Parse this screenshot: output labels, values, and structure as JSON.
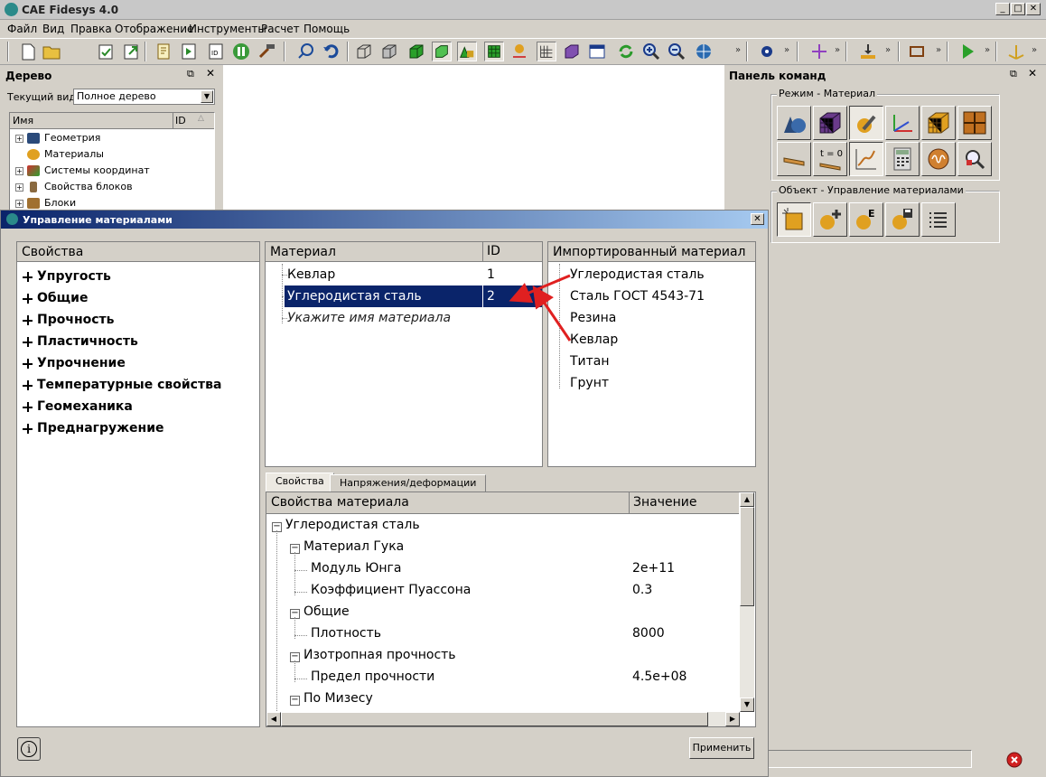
{
  "app": {
    "title": "CAE Fidesys 4.0",
    "minimize": "_",
    "maximize": "□",
    "close": "✕"
  },
  "menu": [
    "Файл",
    "Вид",
    "Правка",
    "Отображение",
    "Инструменты",
    "Расчет",
    "Помощь"
  ],
  "tree_panel": {
    "title": "Дерево",
    "view_label": "Текущий вид",
    "view_value": "Полное дерево",
    "col_name": "Имя",
    "col_id": "ID",
    "items": [
      "Геометрия",
      "Материалы",
      "Системы координат",
      "Свойства блоков",
      "Блоки"
    ]
  },
  "command_panel": {
    "title": "Панель команд",
    "mode_group": "Режим - Материал",
    "object_group": "Объект - Управление материалами",
    "t0_label": "t = 0"
  },
  "dialog": {
    "title": "Управление материалами",
    "properties_header": "Свойства",
    "properties": [
      "Упругость",
      "Общие",
      "Прочность",
      "Пластичность",
      "Упрочнение",
      "Температурные свойства",
      "Геомеханика",
      "Преднагружение"
    ],
    "material_header": "Материал",
    "id_header": "ID",
    "materials": [
      {
        "name": "Кевлар",
        "id": "1"
      },
      {
        "name": "Углеродистая сталь",
        "id": "2"
      }
    ],
    "new_material_hint": "Укажите имя материала",
    "imported_header": "Импортированный материал",
    "imported": [
      "Углеродистая сталь",
      "Сталь ГОСТ 4543-71",
      "Резина",
      "Кевлар",
      "Титан",
      "Грунт"
    ],
    "tabs": [
      "Свойства",
      "Напряжения/деформации"
    ],
    "prop_col": "Свойства материала",
    "value_col": "Значение",
    "prop_tree": {
      "root": "Углеродистая сталь",
      "hooke": "Материал Гука",
      "young": "Модуль Юнга",
      "young_val": "2e+11",
      "poisson": "Коэффициент Пуассона",
      "poisson_val": "0.3",
      "general": "Общие",
      "density": "Плотность",
      "density_val": "8000",
      "iso": "Изотропная прочность",
      "ultimate": "Предел прочности",
      "ultimate_val": "4.5e+08",
      "mises": "По Мизесу"
    },
    "apply": "Применить",
    "info": "i"
  },
  "colors": {
    "selection": "#0a246a",
    "annotation_arrow": "#e02020"
  }
}
